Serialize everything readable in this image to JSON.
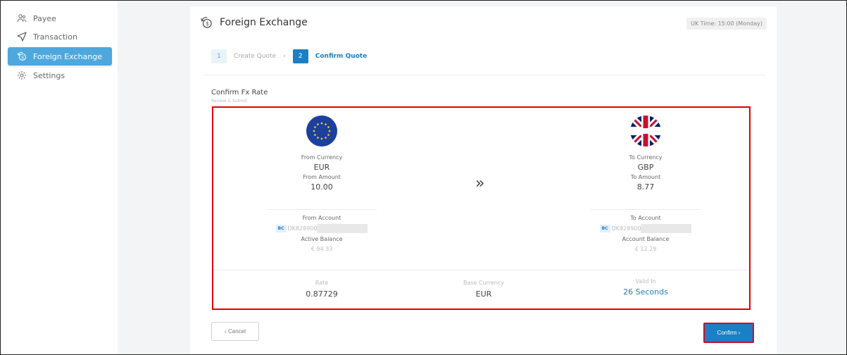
{
  "sidebar": {
    "items": [
      {
        "label": "Payee",
        "icon": "users-icon"
      },
      {
        "label": "Transaction",
        "icon": "send-icon"
      },
      {
        "label": "Foreign Exchange",
        "icon": "exchange-icon",
        "active": true
      },
      {
        "label": "Settings",
        "icon": "gear-icon"
      }
    ]
  },
  "header": {
    "title": "Foreign Exchange",
    "uk_time": "UK Time: 15:00 (Monday)"
  },
  "steps": [
    {
      "number": "1",
      "label": "Create Quote",
      "state": "inactive"
    },
    {
      "number": "2",
      "label": "Confirm Quote",
      "state": "active"
    }
  ],
  "section": {
    "title": "Confirm Fx Rate",
    "subtitle": "Review & Submit"
  },
  "from": {
    "currency_label": "From Currency",
    "currency": "EUR",
    "amount_label": "From Amount",
    "amount": "10.00",
    "account_label": "From Account",
    "badge": "BC",
    "account": "DK828900",
    "balance_label": "Active Balance",
    "balance": "€ 94.33"
  },
  "to": {
    "currency_label": "To Currency",
    "currency": "GBP",
    "amount_label": "To Amount",
    "amount": "8.77",
    "account_label": "To Account",
    "badge": "BC",
    "account": "DK828900",
    "balance_label": "Account Balance",
    "balance": "£ 12.29"
  },
  "arrow": "»",
  "summary": {
    "rate_label": "Rate",
    "rate": "0.87729",
    "base_label": "Base Currency",
    "base": "EUR",
    "valid_label": "Valid In",
    "valid": "26 Seconds"
  },
  "buttons": {
    "cancel": "‹ Cancel",
    "confirm": "Confirm ›"
  },
  "colors": {
    "accent": "#1a7fc4",
    "sidebar_active": "#4ea7dd",
    "highlight_border": "#e00000"
  }
}
